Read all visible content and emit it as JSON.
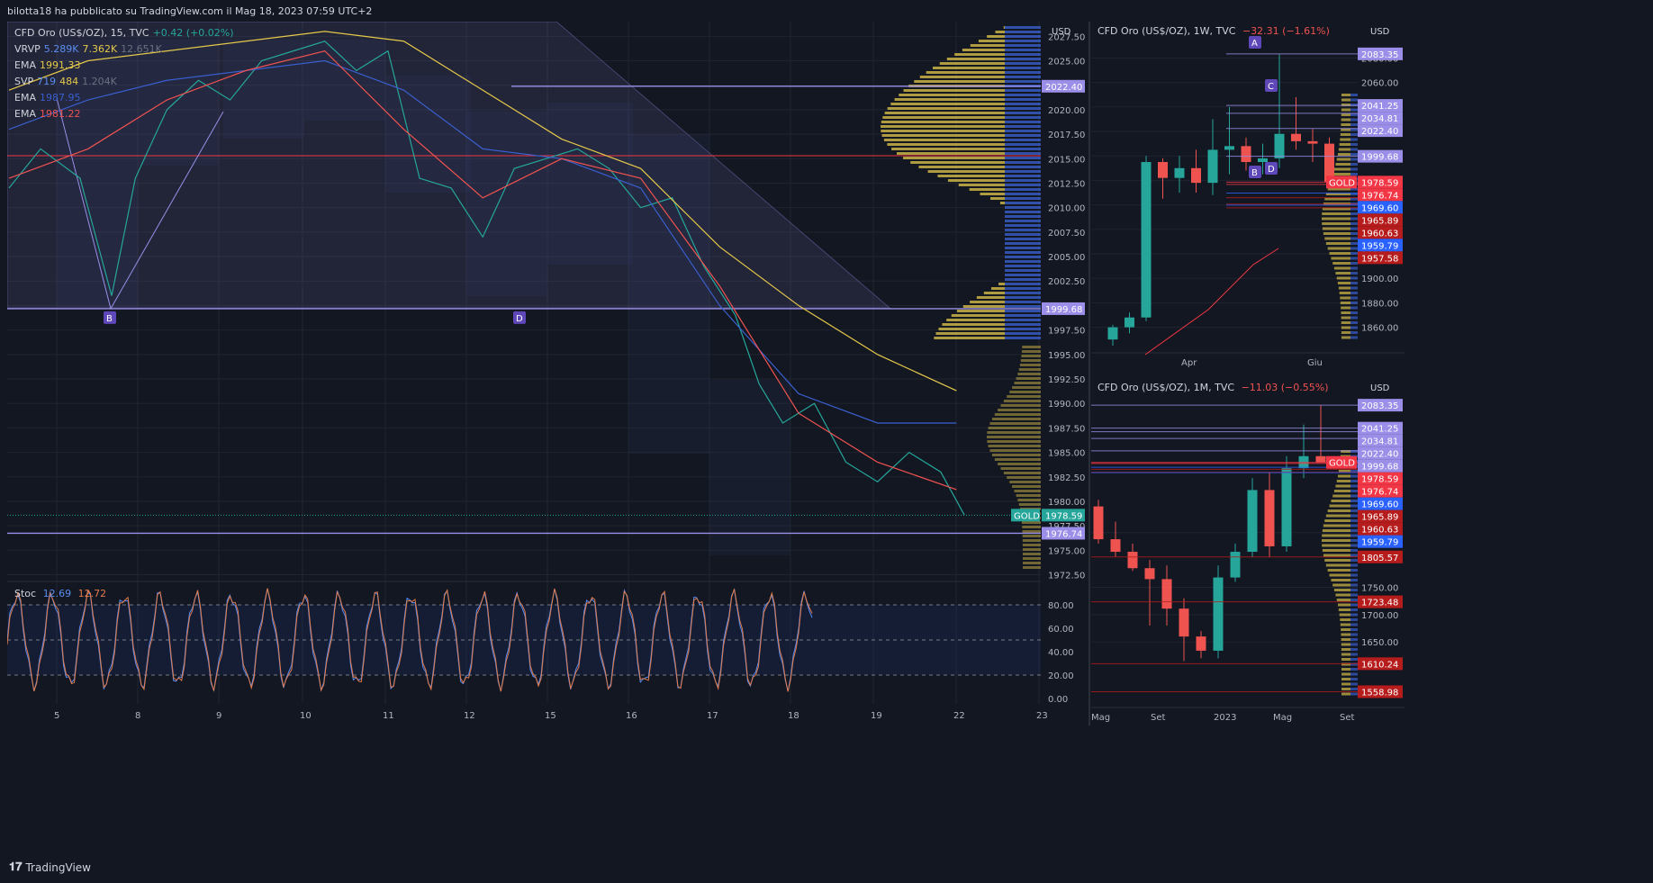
{
  "caption": "bilotta18 ha pubblicato su TradingView.com il Mag 18, 2023 07:59 UTC+2",
  "brand": "TradingView",
  "colors": {
    "bg": "#131722",
    "grid": "#1f2430",
    "bull": "#26a69a",
    "bear": "#ef5350",
    "yellow": "#e5c94b",
    "blue": "#3a5fcd",
    "purple": "#9b8ee8",
    "red": "#f23645",
    "stoch": "#e07a4a"
  },
  "main": {
    "legend": [
      {
        "name": "CFD Oro (US$/OZ), 15, TVC",
        "values": [
          {
            "t": "+0.42 (+0.02%)",
            "c": "#26a69a"
          }
        ]
      },
      {
        "name": "VRVP",
        "values": [
          {
            "t": "5.289K",
            "c": "#5b8def"
          },
          {
            "t": "7.362K",
            "c": "#e5c94b"
          },
          {
            "t": "12.651K",
            "c": "#6b7080"
          }
        ]
      },
      {
        "name": "EMA",
        "values": [
          {
            "t": "1991.33",
            "c": "#e5c94b"
          }
        ]
      },
      {
        "name": "SVP",
        "values": [
          {
            "t": "719",
            "c": "#5b8def"
          },
          {
            "t": "484",
            "c": "#e5c94b"
          },
          {
            "t": "1.204K",
            "c": "#6b7080"
          }
        ]
      },
      {
        "name": "EMA",
        "values": [
          {
            "t": "1987.95",
            "c": "#3a5fcd"
          }
        ]
      },
      {
        "name": "EMA",
        "values": [
          {
            "t": "1981.22",
            "c": "#ef5350"
          }
        ]
      }
    ],
    "currency": "USD",
    "stoch_legend": {
      "name": "Stoc",
      "k": "12.69",
      "d": "12.72"
    },
    "markers": [
      "B",
      "D"
    ],
    "chart_data": {
      "type": "line",
      "title": "CFD Oro (US$/OZ), 15, TVC",
      "x_ticks": [
        "5",
        "8",
        "9",
        "10",
        "11",
        "12",
        "15",
        "16",
        "17",
        "18",
        "19",
        "22",
        "23"
      ],
      "y_ticks": [
        "2027.50",
        "2025.00",
        "2022.50",
        "2020.00",
        "2017.50",
        "2015.00",
        "2012.50",
        "2010.00",
        "2007.50",
        "2005.00",
        "2002.50",
        "2000.00",
        "1997.50",
        "1995.00",
        "1992.50",
        "1990.00",
        "1987.50",
        "1985.00",
        "1982.50",
        "1980.00",
        "1977.50",
        "1975.00",
        "1972.50"
      ],
      "ylim": [
        1972,
        2029
      ],
      "price_labels": [
        {
          "text": "2022.40",
          "value": 2022.4,
          "bg": "#9b8ee8"
        },
        {
          "text": "1999.68",
          "value": 1999.68,
          "bg": "#9b8ee8"
        },
        {
          "text": "1978.59",
          "value": 1978.59,
          "bg": "#26a69a"
        },
        {
          "text": "1976.74",
          "value": 1976.74,
          "bg": "#9b8ee8"
        }
      ],
      "gold_tag": "GOLD",
      "series": [
        {
          "name": "Price",
          "color": "#26a69a",
          "values": [
            [
              0,
              2012
            ],
            [
              0.4,
              2016
            ],
            [
              0.9,
              2013
            ],
            [
              1.3,
              2001
            ],
            [
              1.6,
              2013
            ],
            [
              2.0,
              2020
            ],
            [
              2.4,
              2023
            ],
            [
              2.8,
              2021
            ],
            [
              3.2,
              2025
            ],
            [
              3.6,
              2026
            ],
            [
              4.0,
              2027
            ],
            [
              4.4,
              2024
            ],
            [
              4.8,
              2026
            ],
            [
              5.2,
              2013
            ],
            [
              5.6,
              2012
            ],
            [
              6.0,
              2007
            ],
            [
              6.4,
              2014
            ],
            [
              6.8,
              2015
            ],
            [
              7.2,
              2016
            ],
            [
              7.6,
              2014
            ],
            [
              8.0,
              2010
            ],
            [
              8.4,
              2011
            ],
            [
              8.8,
              2004
            ],
            [
              9.2,
              1999
            ],
            [
              9.5,
              1992
            ],
            [
              9.8,
              1988
            ],
            [
              10.2,
              1990
            ],
            [
              10.6,
              1984
            ],
            [
              11.0,
              1982
            ],
            [
              11.4,
              1985
            ],
            [
              11.8,
              1983
            ],
            [
              12.1,
              1978.6
            ]
          ]
        },
        {
          "name": "EMA",
          "color": "#e5c94b",
          "values": [
            [
              0,
              2022
            ],
            [
              1,
              2025
            ],
            [
              2,
              2026
            ],
            [
              3,
              2027
            ],
            [
              4,
              2028
            ],
            [
              5,
              2027
            ],
            [
              6,
              2022
            ],
            [
              7,
              2017
            ],
            [
              8,
              2014
            ],
            [
              9,
              2006
            ],
            [
              10,
              2000
            ],
            [
              11,
              1995
            ],
            [
              12,
              1991.3
            ]
          ]
        },
        {
          "name": "EMA",
          "color": "#3a5fcd",
          "values": [
            [
              0,
              2018
            ],
            [
              1,
              2021
            ],
            [
              2,
              2023
            ],
            [
              3,
              2024
            ],
            [
              4,
              2025
            ],
            [
              5,
              2022
            ],
            [
              6,
              2016
            ],
            [
              7,
              2015
            ],
            [
              8,
              2012
            ],
            [
              9,
              2000
            ],
            [
              10,
              1991
            ],
            [
              11,
              1988
            ],
            [
              12,
              1988
            ]
          ]
        },
        {
          "name": "EMA",
          "color": "#ef5350",
          "values": [
            [
              0,
              2013
            ],
            [
              1,
              2016
            ],
            [
              2,
              2021
            ],
            [
              3,
              2024
            ],
            [
              4,
              2026
            ],
            [
              5,
              2018
            ],
            [
              6,
              2011
            ],
            [
              7,
              2015
            ],
            [
              8,
              2013
            ],
            [
              9,
              2002
            ],
            [
              10,
              1989
            ],
            [
              11,
              1984
            ],
            [
              12,
              1981.2
            ]
          ]
        }
      ]
    },
    "stoch_chart": {
      "type": "line",
      "y_ticks": [
        "80.00",
        "60.00",
        "40.00",
        "20.00",
        "0.00"
      ],
      "ylim": [
        0,
        100
      ],
      "bands": [
        20,
        50,
        80
      ]
    }
  },
  "weekly": {
    "title": "CFD Oro (US$/OZ), 1W, TVC",
    "change": "−32.31 (−1.61%)",
    "currency": "USD",
    "markers": [
      "A",
      "C",
      "B",
      "D"
    ],
    "gold_tag": "GOLD",
    "chart_data": {
      "type": "bar",
      "title": "CFD Oro (US$/OZ), 1W, TVC",
      "x_ticks": [
        "Apr",
        "Giu"
      ],
      "y_ticks": [
        "2080.00",
        "2060.00",
        "2040.00",
        "2020.00",
        "2000.00",
        "1980.00",
        "1960.00",
        "1940.00",
        "1920.00",
        "1900.00",
        "1880.00",
        "1860.00"
      ],
      "ylim": [
        1845,
        2095
      ],
      "candles": [
        {
          "o": 1850,
          "h": 1862,
          "l": 1845,
          "c": 1860
        },
        {
          "o": 1860,
          "h": 1872,
          "l": 1855,
          "c": 1868
        },
        {
          "o": 1868,
          "h": 2000,
          "l": 1865,
          "c": 1995
        },
        {
          "o": 1995,
          "h": 1998,
          "l": 1965,
          "c": 1982
        },
        {
          "o": 1982,
          "h": 2000,
          "l": 1970,
          "c": 1990
        },
        {
          "o": 1990,
          "h": 2005,
          "l": 1970,
          "c": 1978
        },
        {
          "o": 1978,
          "h": 2030,
          "l": 1968,
          "c": 2005
        },
        {
          "o": 2005,
          "h": 2040,
          "l": 1985,
          "c": 2008
        },
        {
          "o": 2008,
          "h": 2015,
          "l": 1988,
          "c": 1995
        },
        {
          "o": 1995,
          "h": 2010,
          "l": 1985,
          "c": 1998
        },
        {
          "o": 1998,
          "h": 2083,
          "l": 1990,
          "c": 2018
        },
        {
          "o": 2018,
          "h": 2048,
          "l": 2005,
          "c": 2012
        },
        {
          "o": 2012,
          "h": 2022,
          "l": 1995,
          "c": 2010
        },
        {
          "o": 2010,
          "h": 2015,
          "l": 1978,
          "c": 1978.6
        }
      ],
      "price_labels": [
        {
          "text": "2083.35",
          "value": 2083.35,
          "bg": "#9b8ee8"
        },
        {
          "text": "2041.25",
          "value": 2041.25,
          "bg": "#9b8ee8"
        },
        {
          "text": "2034.81",
          "value": 2034.81,
          "bg": "#9b8ee8"
        },
        {
          "text": "2022.40",
          "value": 2022.4,
          "bg": "#9b8ee8"
        },
        {
          "text": "1999.68",
          "value": 1999.68,
          "bg": "#9b8ee8"
        },
        {
          "text": "1978.59",
          "value": 1978.59,
          "bg": "#f23645"
        },
        {
          "text": "1976.74",
          "value": 1976.74,
          "bg": "#f23645"
        },
        {
          "text": "1969.60",
          "value": 1969.6,
          "bg": "#2962ff"
        },
        {
          "text": "1965.89",
          "value": 1965.89,
          "bg": "#b71c1c"
        },
        {
          "text": "1960.63",
          "value": 1960.63,
          "bg": "#b71c1c"
        },
        {
          "text": "1959.79",
          "value": 1959.79,
          "bg": "#2962ff"
        },
        {
          "text": "1957.58",
          "value": 1957.58,
          "bg": "#b71c1c"
        }
      ]
    }
  },
  "monthly": {
    "title": "CFD Oro (US$/OZ), 1M, TVC",
    "change": "−11.03 (−0.55%)",
    "currency": "USD",
    "gold_tag": "GOLD",
    "chart_data": {
      "type": "bar",
      "title": "CFD Oro (US$/OZ), 1M, TVC",
      "x_ticks": [
        "Mag",
        "Set",
        "2023",
        "Mag",
        "Set"
      ],
      "y_ticks": [
        "1850.00",
        "1750.00",
        "1700.00",
        "1650.00"
      ],
      "ylim": [
        1540,
        2100
      ],
      "candles": [
        {
          "o": 1898,
          "h": 1910,
          "l": 1830,
          "c": 1838
        },
        {
          "o": 1838,
          "h": 1870,
          "l": 1806,
          "c": 1815
        },
        {
          "o": 1815,
          "h": 1830,
          "l": 1780,
          "c": 1785
        },
        {
          "o": 1785,
          "h": 1800,
          "l": 1680,
          "c": 1765
        },
        {
          "o": 1765,
          "h": 1790,
          "l": 1680,
          "c": 1711
        },
        {
          "o": 1711,
          "h": 1730,
          "l": 1615,
          "c": 1660
        },
        {
          "o": 1660,
          "h": 1670,
          "l": 1620,
          "c": 1634
        },
        {
          "o": 1634,
          "h": 1790,
          "l": 1620,
          "c": 1768
        },
        {
          "o": 1768,
          "h": 1830,
          "l": 1760,
          "c": 1815
        },
        {
          "o": 1815,
          "h": 1950,
          "l": 1805,
          "c": 1928
        },
        {
          "o": 1928,
          "h": 1960,
          "l": 1805,
          "c": 1825
        },
        {
          "o": 1825,
          "h": 1990,
          "l": 1815,
          "c": 1968
        },
        {
          "o": 1968,
          "h": 2048,
          "l": 1950,
          "c": 1990
        },
        {
          "o": 1990,
          "h": 2083,
          "l": 1980,
          "c": 1978.6
        }
      ],
      "price_labels": [
        {
          "text": "2083.35",
          "value": 2083.35,
          "bg": "#9b8ee8"
        },
        {
          "text": "2041.25",
          "value": 2041.25,
          "bg": "#9b8ee8"
        },
        {
          "text": "2034.81",
          "value": 2034.81,
          "bg": "#9b8ee8"
        },
        {
          "text": "2022.40",
          "value": 2022.4,
          "bg": "#9b8ee8"
        },
        {
          "text": "1999.68",
          "value": 1999.68,
          "bg": "#9b8ee8"
        },
        {
          "text": "1978.59",
          "value": 1978.59,
          "bg": "#f23645"
        },
        {
          "text": "1976.74",
          "value": 1976.74,
          "bg": "#f23645"
        },
        {
          "text": "1969.60",
          "value": 1969.6,
          "bg": "#2962ff"
        },
        {
          "text": "1965.89",
          "value": 1965.89,
          "bg": "#b71c1c"
        },
        {
          "text": "1960.63",
          "value": 1960.63,
          "bg": "#b71c1c"
        },
        {
          "text": "1959.79",
          "value": 1959.79,
          "bg": "#2962ff"
        },
        {
          "text": "1805.57",
          "value": 1805.57,
          "bg": "#b71c1c"
        },
        {
          "text": "1723.48",
          "value": 1723.48,
          "bg": "#b71c1c"
        },
        {
          "text": "1610.24",
          "value": 1610.24,
          "bg": "#b71c1c"
        },
        {
          "text": "1558.98",
          "value": 1558.98,
          "bg": "#b71c1c"
        }
      ]
    }
  }
}
